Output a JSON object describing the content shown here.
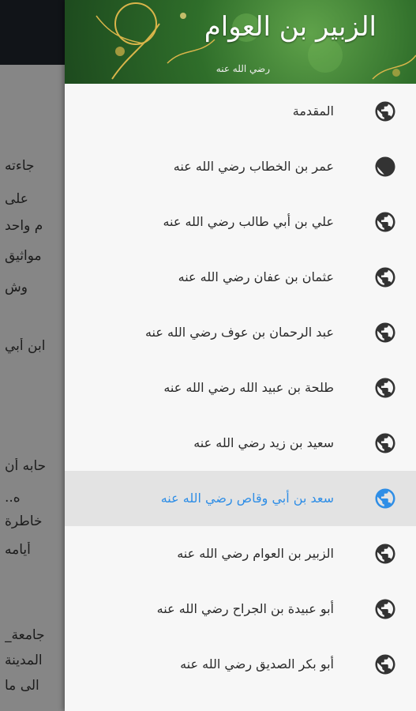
{
  "header": {
    "title": "الزبير بن العوام",
    "subtitle": "رضي الله عنه",
    "image_name": "green-ornamental-header"
  },
  "background_text": [
    "جاءته",
    "على",
    "م واحد",
    "مواثيق",
    "وش",
    "ابن أبي",
    "حابه أن",
    "ه..",
    "خاطرة",
    "أيامه",
    "جامعة_",
    "المدينة",
    "الى ما"
  ],
  "menu": {
    "active_index": 7,
    "accent_color": "#2f8ee6",
    "items": [
      {
        "label": "المقدمة",
        "icon": "globe-icon"
      },
      {
        "label": "عمر بن الخطاب رضي الله عنه",
        "icon": "globe-icon"
      },
      {
        "label": "علي بن أبي طالب رضي الله عنه",
        "icon": "globe-icon"
      },
      {
        "label": "عثمان بن عفان رضي الله عنه",
        "icon": "globe-icon"
      },
      {
        "label": "عبد الرحمان بن عوف رضي الله عنه",
        "icon": "globe-icon"
      },
      {
        "label": "طلحة بن عبيد الله رضي الله عنه",
        "icon": "globe-icon"
      },
      {
        "label": "سعيد بن زيد رضي الله عنه",
        "icon": "globe-icon"
      },
      {
        "label": "سعد بن أبي وقاص رضي الله عنه",
        "icon": "globe-icon"
      },
      {
        "label": "الزبير بن العوام رضي الله عنه",
        "icon": "globe-icon"
      },
      {
        "label": "أبو عبيدة بن الجراح رضي الله عنه",
        "icon": "globe-icon"
      },
      {
        "label": "أبو بكر الصديق رضي الله عنه",
        "icon": "globe-icon"
      }
    ]
  }
}
